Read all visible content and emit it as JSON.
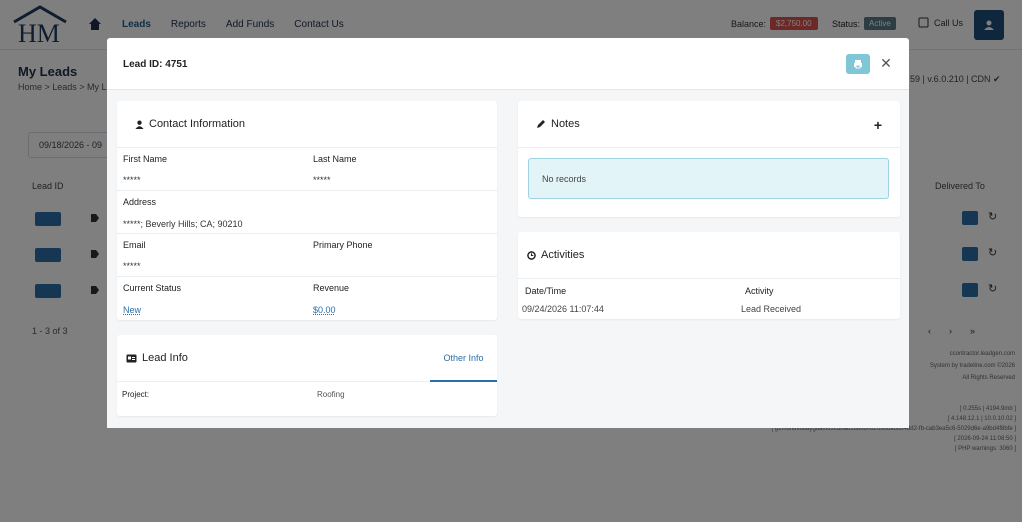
{
  "nav": {
    "items": [
      "Leads",
      "Reports",
      "Add Funds",
      "Contact Us"
    ],
    "balance_label": "Balance:",
    "balance_value": "$2,750.00",
    "status_label": "Status:",
    "status_value": "Active",
    "call_us": "Call Us"
  },
  "page": {
    "title": "My Leads",
    "breadcrumb": "Home > Leads > My L",
    "version": "59 | v.6.0.210 | CDN ✔",
    "date_range": "09/18/2026 - 09",
    "col_lead_id": "Lead ID",
    "col_delivered_to": "Delivered To",
    "count": "1 - 3 of 3",
    "pager": [
      "‹",
      "›",
      "»"
    ],
    "footer": [
      "ccontractor.leadgen.com",
      "System by tradeline.com ©2026",
      "All Rights Reserved"
    ],
    "footer2": [
      "[ 0.255s | 4194.9mb ]",
      "[ 4.148.12.1 | 10.0.10.02 ]",
      "[ g1mdhdfl8daygdal0d3cd8ab3dd8d0d26d8dabd84dd2-fb-cab3ea5c6-5029d6e-a9bd4f8bfe ]",
      "[ 2026-09-24 11:08:50 ]",
      "[ PHP warnings: 3060 ]"
    ]
  },
  "modal": {
    "title": "Lead ID: 4751",
    "contact": {
      "heading": "Contact Information",
      "first_name_label": "First Name",
      "first_name": "*****",
      "last_name_label": "Last Name",
      "last_name": "*****",
      "address_label": "Address",
      "address": "*****; Beverly Hills; CA; 90210",
      "email_label": "Email",
      "email": "*****",
      "phone_label": "Primary Phone",
      "status_label": "Current Status",
      "status": "New",
      "revenue_label": "Revenue",
      "revenue": "$0.00"
    },
    "notes": {
      "heading": "Notes",
      "add": "+",
      "empty": "No records"
    },
    "activities": {
      "heading": "Activities",
      "col_datetime": "Date/Time",
      "col_activity": "Activity",
      "rows": [
        {
          "datetime": "09/24/2026 11:07:44",
          "activity": "Lead Received"
        }
      ]
    },
    "lead_info": {
      "heading": "Lead Info",
      "other_tab": "Other Info",
      "project_label": "Project:",
      "project_value": "Roofing"
    }
  }
}
